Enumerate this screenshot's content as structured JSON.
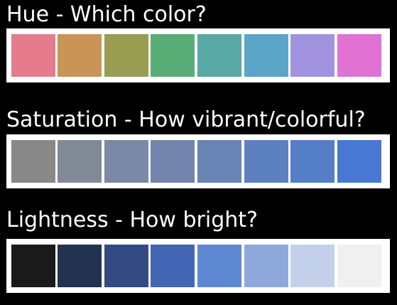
{
  "sections": [
    {
      "title": "Hue - Which color?",
      "colors": [
        "#e67b8c",
        "#c99455",
        "#989d52",
        "#59ae78",
        "#58a8a4",
        "#5aa5c8",
        "#a293e0",
        "#e172d3"
      ]
    },
    {
      "title": "Saturation - How vibrant/colorful?",
      "colors": [
        "#888888",
        "#828a98",
        "#7b89a6",
        "#7385ac",
        "#6884b4",
        "#5d80bf",
        "#547ec6",
        "#4878d2"
      ]
    },
    {
      "title": "Lightness - How bright?",
      "colors": [
        "#1a1a1a",
        "#233250",
        "#334b82",
        "#4366b4",
        "#5f88d2",
        "#8ea8dc",
        "#c3d0e9",
        "#f0f0f0"
      ]
    }
  ]
}
